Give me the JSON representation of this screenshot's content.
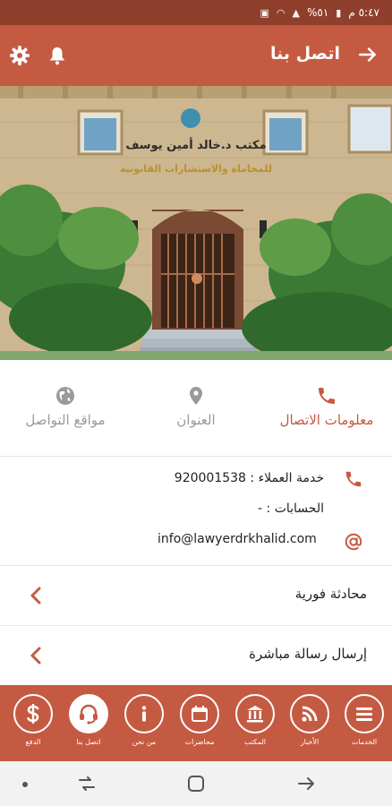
{
  "status_bar": {
    "time": "٥:٤٧ م",
    "battery": "٥١%"
  },
  "header": {
    "title": "اتصل بنا"
  },
  "hero": {
    "sign_line1": "مكتب د.خالد أمين يوسف",
    "sign_line2": "للمحاماة والاستشارات القانونية"
  },
  "tabs": [
    {
      "label": "معلومات الاتصال",
      "icon": "phone-icon",
      "active": true
    },
    {
      "label": "العنوان",
      "icon": "location-pin-icon",
      "active": false
    },
    {
      "label": "مواقع التواصل",
      "icon": "globe-icon",
      "active": false
    }
  ],
  "contact": {
    "customer_service_label": "خدمة العملاء :",
    "customer_service_value": "920001538",
    "accounts_label": "الحسابات :",
    "accounts_value": "-",
    "email": "info@lawyerdrkhalid.com"
  },
  "actions": [
    {
      "label": "محادثة فورية"
    },
    {
      "label": "إرسال رسالة مباشرة"
    }
  ],
  "bottom_nav": [
    {
      "label": "الخدمات",
      "icon": "menu-icon"
    },
    {
      "label": "الأخبار",
      "icon": "rss-icon"
    },
    {
      "label": "المكتب",
      "icon": "bank-icon"
    },
    {
      "label": "محاضرات",
      "icon": "calendar-icon"
    },
    {
      "label": "من نحن",
      "icon": "info-icon"
    },
    {
      "label": "اتصل بنا",
      "icon": "headset-icon",
      "active": true
    },
    {
      "label": "الدفع",
      "icon": "dollar-icon"
    }
  ],
  "colors": {
    "primary": "#c55a42",
    "status_bar": "#8f3f2c",
    "active_text": "#c55a42",
    "inactive_text": "#9a9a9a"
  }
}
